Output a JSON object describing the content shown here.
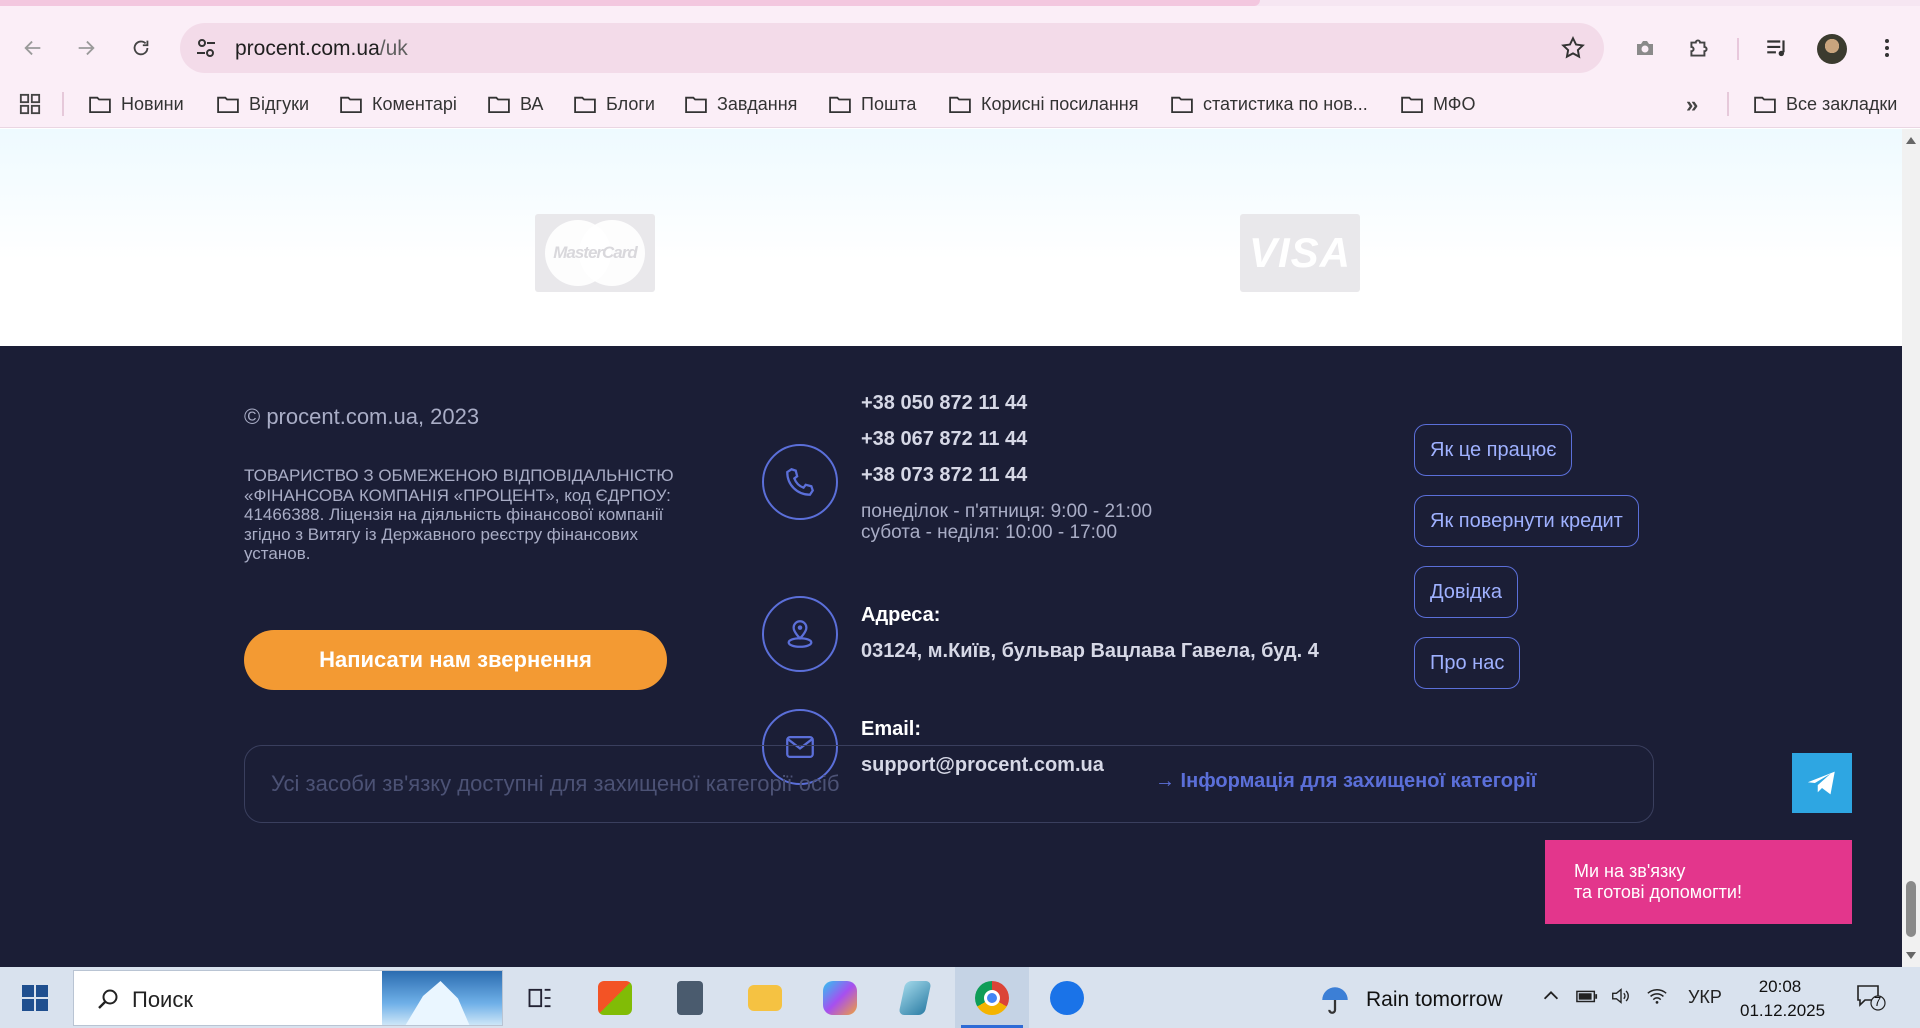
{
  "browser": {
    "url_host": "procent.com.ua",
    "url_path": "/uk",
    "bookmarks": [
      "Новини",
      "Відгуки",
      "Коментарі",
      "ВА",
      "Блоги",
      "Завдання",
      "Пошта",
      "Корисні посилання",
      "статистика по нов...",
      "МФО"
    ],
    "all_bookmarks": "Все закладки"
  },
  "payments": {
    "mastercard": "MasterCard",
    "visa": "VISA"
  },
  "footer": {
    "copyright": "© procent.com.ua, 2023",
    "legal": "ТОВАРИСТВО З ОБМЕЖЕНОЮ ВІДПОВІДАЛЬНІСТЮ «ФІНАНСОВА КОМПАНІЯ «ПРОЦЕНТ», код ЄДРПОУ: 41466388. Ліцензія на діяльність фінансової компанії згідно з Витягу із Державного реєстру фінансових установ.",
    "cta": "Написати нам звернення",
    "phones": [
      "+38 050 872 11 44",
      "+38 067 872 11 44",
      "+38 073 872 11 44"
    ],
    "hours": [
      "понеділок - п'ятниця: 9:00 - 21:00",
      "субота - неділя: 10:00 - 17:00"
    ],
    "address_label": "Адреса:",
    "address": "03124, м.Київ, бульвар Вацлава Гавела, буд. 4",
    "email_label": "Email:",
    "email": "support@procent.com.ua",
    "links": [
      "Як це працює",
      "Як повернути кредит",
      "Довідка",
      "Про нас"
    ],
    "protected_text": "Усі засоби зв'язку доступні для захищеної категорії осіб",
    "protected_link": "→ Інформація для захищеної категорії",
    "chat_line1": "Ми на зв'язку",
    "chat_line2": "та готові допомогти!"
  },
  "taskbar": {
    "search": "Поиск",
    "weather": "Rain tomorrow",
    "lang": "УКР",
    "time": "20:08",
    "date": "01.12.2025",
    "notifications": "7"
  },
  "colors": {
    "footer_bg": "#1b1e36",
    "accent_orange": "#f39a33",
    "accent_blue": "#5b6fd9",
    "chat_pink": "#e3368c",
    "telegram_blue": "#2ea6e2"
  }
}
